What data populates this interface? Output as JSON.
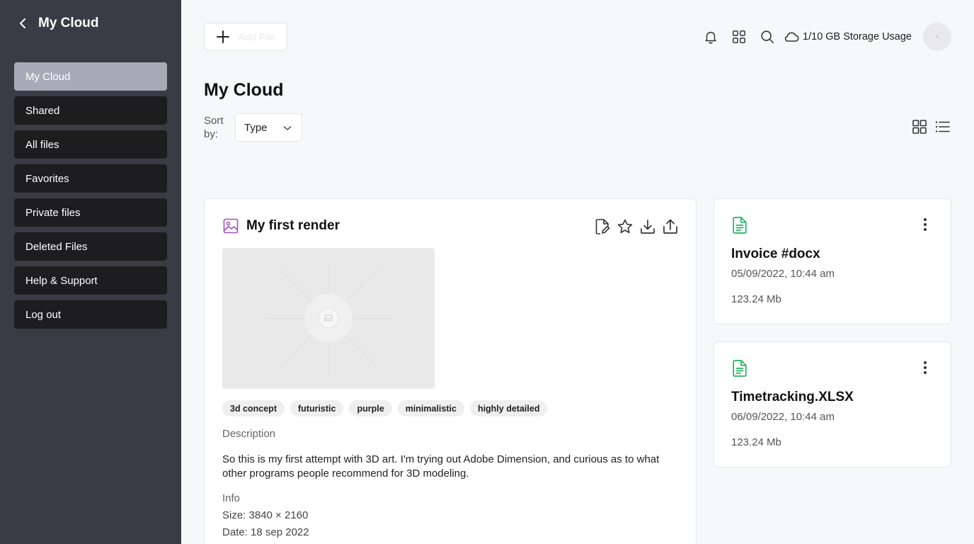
{
  "sidebar": {
    "title": "My Cloud",
    "items": [
      {
        "label": "My Cloud"
      },
      {
        "label": "Shared"
      },
      {
        "label": "All files"
      },
      {
        "label": "Favorites"
      },
      {
        "label": "Private files"
      },
      {
        "label": "Deleted Files"
      },
      {
        "label": "Help & Support"
      },
      {
        "label": "Log out"
      }
    ],
    "active_item": "My Cloud"
  },
  "topbar": {
    "add_file_label": "Add File",
    "storage_label": "1/10 GB Storage Usage",
    "icons": [
      "bell-icon",
      "apps-grid-icon",
      "search-icon",
      "cloud-icon"
    ]
  },
  "main": {
    "title": "My Cloud",
    "sort_label": "Sort by:",
    "sort_value": "Type",
    "view_modes": [
      "grid-view-icon",
      "list-view-icon"
    ]
  },
  "featured_file": {
    "title": "My first render",
    "type_icon": "image-icon",
    "actions": [
      "edit-file-icon",
      "star-icon",
      "download-icon",
      "share-icon"
    ],
    "tags": [
      "3d concept",
      "futuristic",
      "purple",
      "minimalistic",
      "highly detailed"
    ],
    "description_label": "Description",
    "description": "So this is my first attempt with 3D art. I'm trying out Adobe Dimension, and curious as to what other programs people recommend for 3D modeling.",
    "info_label": "Info",
    "info_size": "Size: 3840 × 2160",
    "info_date": "Date: 18 sep 2022"
  },
  "files": [
    {
      "name": "Invoice #docx",
      "date": "05/09/2022, 10:44 am",
      "size": "123.24 Mb"
    },
    {
      "name": "Timetracking.XLSX",
      "date": "06/09/2022, 10:44 am",
      "size": "123.24 Mb"
    }
  ],
  "colors": {
    "sidebar_bg": "#3a3b45",
    "nav_item_bg": "#1d1d1f",
    "nav_active_bg": "#a9aab8",
    "image_icon": "#a24fc2",
    "file_icon": "#22b45e"
  }
}
